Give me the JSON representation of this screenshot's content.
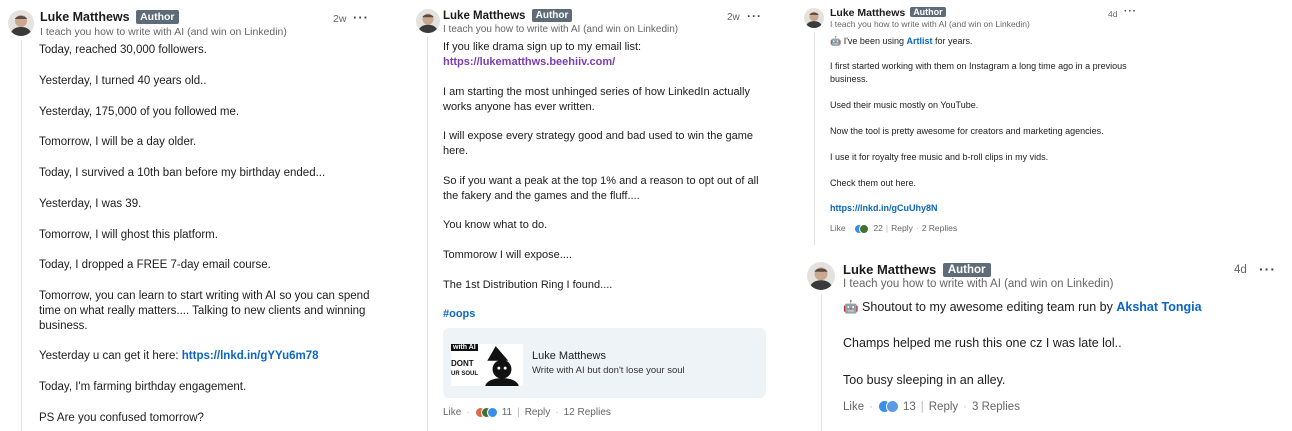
{
  "colors": {
    "badge": "#5e6b78",
    "link": "#0a66c2",
    "link_purple": "#7a3db3",
    "like": "#378fe9",
    "celebrate": "#44712e"
  },
  "comment1": {
    "author": "Luke Matthews",
    "badge": "Author",
    "headline": "I teach you how to write with AI (and win on Linkedin)",
    "time": "2w",
    "menu": "···",
    "lines": [
      "Today, reached 30,000 followers.",
      "Yesterday, I turned 40 years old..",
      "Yesterday, 175,000 of you followed me.",
      "Tomorrow, I will be a day older.",
      "Today, I survived a 10th ban before my birthday ended...",
      "Yesterday, I was 39.",
      "Tomorrow, I will ghost this platform.",
      "Today, I dropped a FREE 7-day email course.",
      "Tomorrow, you can learn to start writing with AI so you can spend",
      "time on what really matters.... Talking to new clients and winning",
      "business.",
      "Yesterday u can get it here: ",
      "Today, I'm farming birthday engagement.",
      "PS Are you confused tomorrow?"
    ],
    "link": "https://lnkd.in/gYYu6m78"
  },
  "comment2": {
    "author": "Luke Matthews",
    "badge": "Author",
    "headline": "I teach you how to write with AI (and win on Linkedin)",
    "time": "2w",
    "menu": "···",
    "lines": [
      "If you like drama sign up to my email list:",
      "https://lukematthws.beehiiv.com/",
      "I am starting the most unhinged series of how LinkedIn actually",
      "works anyone has ever written.",
      "I will expose every strategy good and bad used to win the game",
      "here.",
      "So if you want a peak at the top 1% and a reason to opt out of all",
      "the fakery and the games and the fluff....",
      "You know what to do.",
      "Tommorow I will expose....",
      "The 1st Distribution Ring I found....",
      "#oops"
    ],
    "card": {
      "title": "Luke Matthews",
      "subtitle": "Write with AI but don't lose your soul",
      "thumb_top": "with AI",
      "thumb_mid": "DONT",
      "thumb_bot": "UR SOUL"
    },
    "actions": {
      "like": "Like",
      "reply": "Reply",
      "count": "11",
      "replies": "12 Replies"
    }
  },
  "comment3": {
    "author": "Luke Matthews",
    "badge": "Author",
    "headline": "I teach you how to write with AI (and win on Linkedin)",
    "time": "4d",
    "menu": "···",
    "line1_pre": "🤖 I've been using ",
    "line1_link": "Artlist",
    "line1_post": " for years.",
    "lines": [
      "I first started working with them on Instagram a long time ago in a previous",
      "business.",
      "Used their music mostly on YouTube.",
      "Now the tool is pretty awesome for creators and marketing agencies.",
      "I use it for royalty free music and b-roll clips in my vids.",
      "Check them out here."
    ],
    "link": "https://lnkd.in/gCuUhy8N",
    "actions": {
      "like": "Like",
      "reply": "Reply",
      "count": "22",
      "replies": "2 Replies"
    }
  },
  "comment4": {
    "author": "Luke Matthews",
    "badge": "Author",
    "headline": "I teach you how to write with AI (and win on Linkedin)",
    "time": "4d",
    "menu": "···",
    "line1_pre": "🤖 Shoutout to my awesome editing team run by ",
    "line1_link": "Akshat Tongia",
    "lines": [
      "Champs helped me rush this one cz I was late lol..",
      "Too busy sleeping in an alley."
    ],
    "actions": {
      "like": "Like",
      "reply": "Reply",
      "count": "13",
      "replies": "3 Replies"
    }
  }
}
